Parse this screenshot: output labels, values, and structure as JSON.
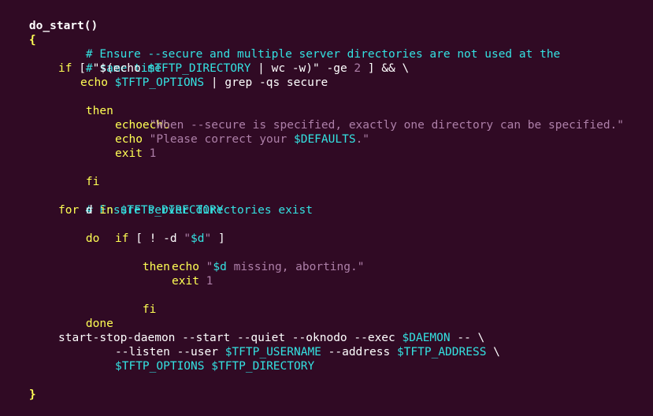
{
  "editor": {
    "function_name": "do_start()",
    "open_brace": "{",
    "close_brace": "}",
    "comment_1a": "# Ensure --secure and multiple server directories are not used at the",
    "comment_1b": "# same time",
    "if1_kw": "if",
    "if1_rest_a": " [ \"$(echo ",
    "if1_var": "$TFTP_DIRECTORY",
    "if1_rest_b": " | wc -w)\" -ge ",
    "if1_num": "2",
    "if1_rest_c": " ] && \\",
    "echo_kw": "echo",
    "opt_var": "$TFTP_OPTIONS",
    "grep_rest": " | grep -qs secure",
    "then_kw": "then",
    "echo_msg1_str": "\"When --secure is specified, exactly one directory can be specified.\"",
    "echo_msg2_str_a": "\"Please correct your ",
    "defaults_var": "$DEFAULTS",
    "echo_msg2_str_b": ".\"",
    "exit_kw": "exit",
    "exit_num": "1",
    "fi_kw": "fi",
    "comment_2": "# Ensure server directories exist",
    "for_kw": "for",
    "for_d": " d ",
    "in_kw": "in",
    "for_var": "$TFTP_DIRECTORY",
    "do_kw": "do",
    "if2_kw": "if",
    "if2_rest_a": " [ ! -d ",
    "if2_str_a": "\"",
    "if2_var": "$d",
    "if2_str_b": "\"",
    "if2_rest_b": " ]",
    "echo_missing_q": "\"",
    "echo_missing_var": "$d",
    "echo_missing_str": " missing, aborting.\"",
    "done_kw": "done",
    "ssd_a": "start-stop-daemon --start --quiet --oknodo --exec ",
    "daemon_var": "$DAEMON",
    "ssd_b": " -- \\",
    "listen_a": "--listen --user ",
    "user_var": "$TFTP_USERNAME",
    "listen_b": " --address ",
    "addr_var": "$TFTP_ADDRESS",
    "listen_c": " \\",
    "last_var1": "$TFTP_OPTIONS",
    "last_sp": " ",
    "last_var2": "$TFTP_DIRECTORY"
  }
}
